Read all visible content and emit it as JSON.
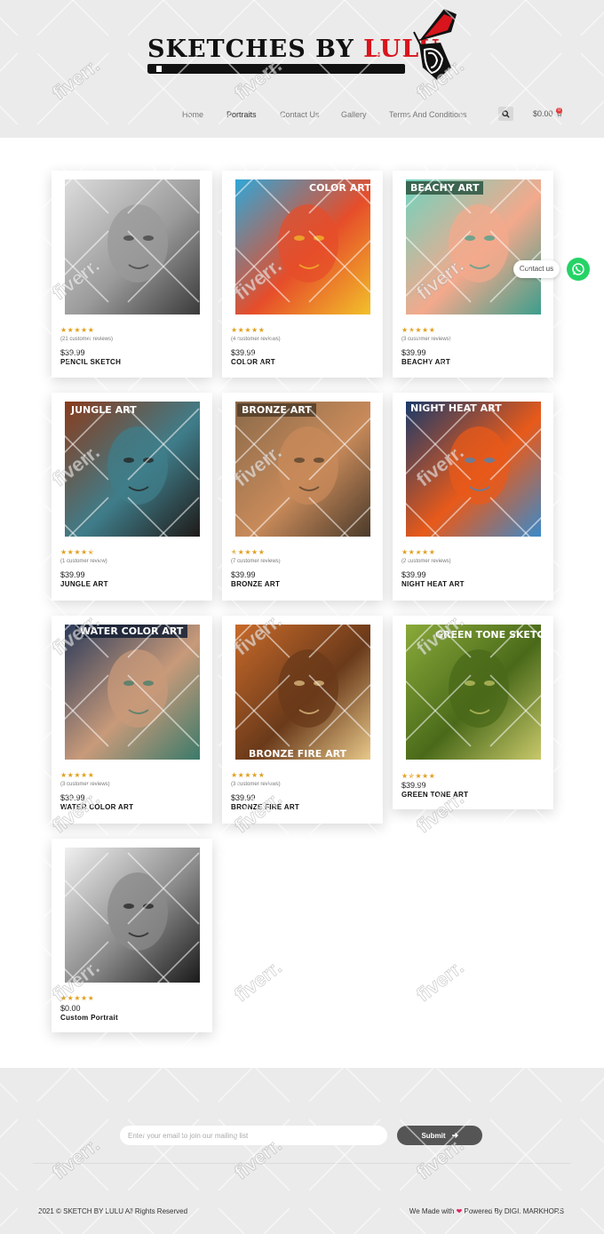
{
  "header": {
    "logo_main": "SKETCHES BY ",
    "logo_accent": "LULU",
    "nav": [
      "Home",
      "Portraits",
      "Contact Us",
      "Gallery",
      "Terms And Conditions"
    ],
    "active_nav": "Portraits",
    "search_icon": "search-icon",
    "cart_total": "$0.00",
    "cart_count": "0"
  },
  "products": [
    {
      "name": "PENCIL SKETCH",
      "price": "$39.99",
      "reviews": "(21 customer reviews)",
      "stars": "★★★★★",
      "label": "",
      "palette": [
        "#dcdcdc",
        "#9a9a9a",
        "#3a3a3a"
      ]
    },
    {
      "name": "COLOR ART",
      "price": "$39.99",
      "reviews": "(4 customer reviews)",
      "stars": "★★★★★",
      "label": "COLOR ART",
      "palette": [
        "#2fa7d8",
        "#e64d2a",
        "#f2c02a"
      ]
    },
    {
      "name": "BEACHY ART",
      "price": "$39.99",
      "reviews": "(3 customer reviews)",
      "stars": "★★★★★",
      "label": "BEACHY ART",
      "palette": [
        "#6fd3bf",
        "#f3a98c",
        "#3c9e8c"
      ]
    },
    {
      "name": "JUNGLE ART",
      "price": "$39.99",
      "reviews": "(1 customer review)",
      "stars": "★★★★★",
      "label": "JUNGLE  ART",
      "palette": [
        "#8a3b1c",
        "#3f7d8a",
        "#1f1a18"
      ]
    },
    {
      "name": "BRONZE ART",
      "price": "$39.99",
      "reviews": "(7 customer reviews)",
      "stars": "★★★★★",
      "label": "BRONZE ART",
      "palette": [
        "#8a6a4a",
        "#c88a5a",
        "#4a3a2a"
      ]
    },
    {
      "name": "NIGHT HEAT ART",
      "price": "$39.99",
      "reviews": "(2 customer reviews)",
      "stars": "★★★★★",
      "label": "NIGHT HEAT  ART",
      "palette": [
        "#1a3a6a",
        "#e85a1a",
        "#3a8aca"
      ]
    },
    {
      "name": "WATER COLOR ART",
      "price": "$39.99",
      "reviews": "(3 customer reviews)",
      "stars": "★★★★★",
      "label": "WATER COLOR ART",
      "palette": [
        "#2a3a5a",
        "#c89a7a",
        "#3a7a6a"
      ]
    },
    {
      "name": "BRONZE FIRE ART",
      "price": "$39.99",
      "reviews": "(3 customer reviews)",
      "stars": "★★★★★",
      "label": "BRONZE  FIRE ART",
      "palette": [
        "#c86a2a",
        "#6a3a1a",
        "#e8c88a"
      ]
    },
    {
      "name": "GREEN TONE ART",
      "price": "$39.99",
      "reviews": "",
      "stars": "★★★★★",
      "label": "GREEN TONE SKETCH",
      "palette": [
        "#8aaa3a",
        "#4a6a1a",
        "#c8c86a"
      ]
    },
    {
      "name": "Custom Portrait",
      "price": "$0.00",
      "reviews": "",
      "stars": "★★★★★",
      "label": "",
      "palette": [
        "#f0f0f0",
        "#8a8a8a",
        "#1a1a1a"
      ]
    }
  ],
  "whatsapp": {
    "label": "Contact us",
    "icon": "whatsapp-icon"
  },
  "footer": {
    "email_placeholder": "Enter your email to join our mailing list",
    "submit_label": "Submit",
    "copyright": "2021 © SKETCH BY LULU All Rights Reserved",
    "made_with_prefix": "We Made with",
    "made_with_suffix": "Powered By DIGI. MARKHORS"
  },
  "watermark": "fiverr."
}
